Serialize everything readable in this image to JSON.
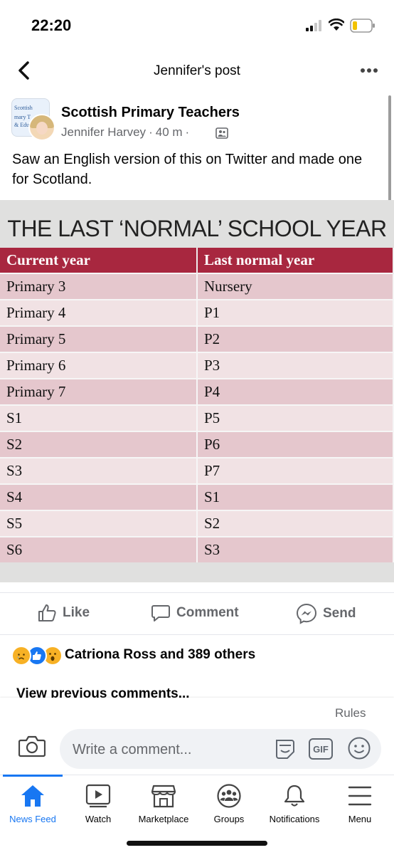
{
  "status_bar": {
    "time": "22:20"
  },
  "header": {
    "title": "Jennifer's post"
  },
  "post": {
    "group_name": "Scottish Primary Teachers",
    "author": "Jennifer Harvey",
    "time": "40 m",
    "text": "Saw an English version of this on Twitter and made one for Scotland.",
    "avatar_lines": [
      "Scottish",
      "mary T",
      "& Edu"
    ]
  },
  "image": {
    "title": "THE LAST ‘NORMAL’ SCHOOL YEAR",
    "columns": [
      "Current year",
      "Last normal year"
    ],
    "rows": [
      [
        "Primary 3",
        "Nursery"
      ],
      [
        "Primary 4",
        "P1"
      ],
      [
        "Primary 5",
        "P2"
      ],
      [
        "Primary 6",
        "P3"
      ],
      [
        "Primary 7",
        "P4"
      ],
      [
        "S1",
        "P5"
      ],
      [
        "S2",
        "P6"
      ],
      [
        "S3",
        "P7"
      ],
      [
        "S4",
        "S1"
      ],
      [
        "S5",
        "S2"
      ],
      [
        "S6",
        "S3"
      ]
    ]
  },
  "actions": {
    "like": "Like",
    "comment": "Comment",
    "send": "Send"
  },
  "reactions": {
    "text": "Catriona Ross and 389 others",
    "icons": [
      "sad-icon",
      "like-icon",
      "wow-icon"
    ]
  },
  "comments": {
    "view_previous": "View previous comments..."
  },
  "composer": {
    "rules": "Rules",
    "placeholder": "Write a comment...",
    "gif": "GIF"
  },
  "tabs": [
    {
      "label": "News Feed",
      "icon": "home-icon"
    },
    {
      "label": "Watch",
      "icon": "watch-icon"
    },
    {
      "label": "Marketplace",
      "icon": "marketplace-icon"
    },
    {
      "label": "Groups",
      "icon": "groups-icon"
    },
    {
      "label": "Notifications",
      "icon": "bell-icon"
    },
    {
      "label": "Menu",
      "icon": "menu-icon"
    }
  ],
  "colors": {
    "accent": "#1877f2",
    "table_header": "#a8273f",
    "row_dark": "#e5c7cd",
    "row_light": "#f1e2e4"
  }
}
